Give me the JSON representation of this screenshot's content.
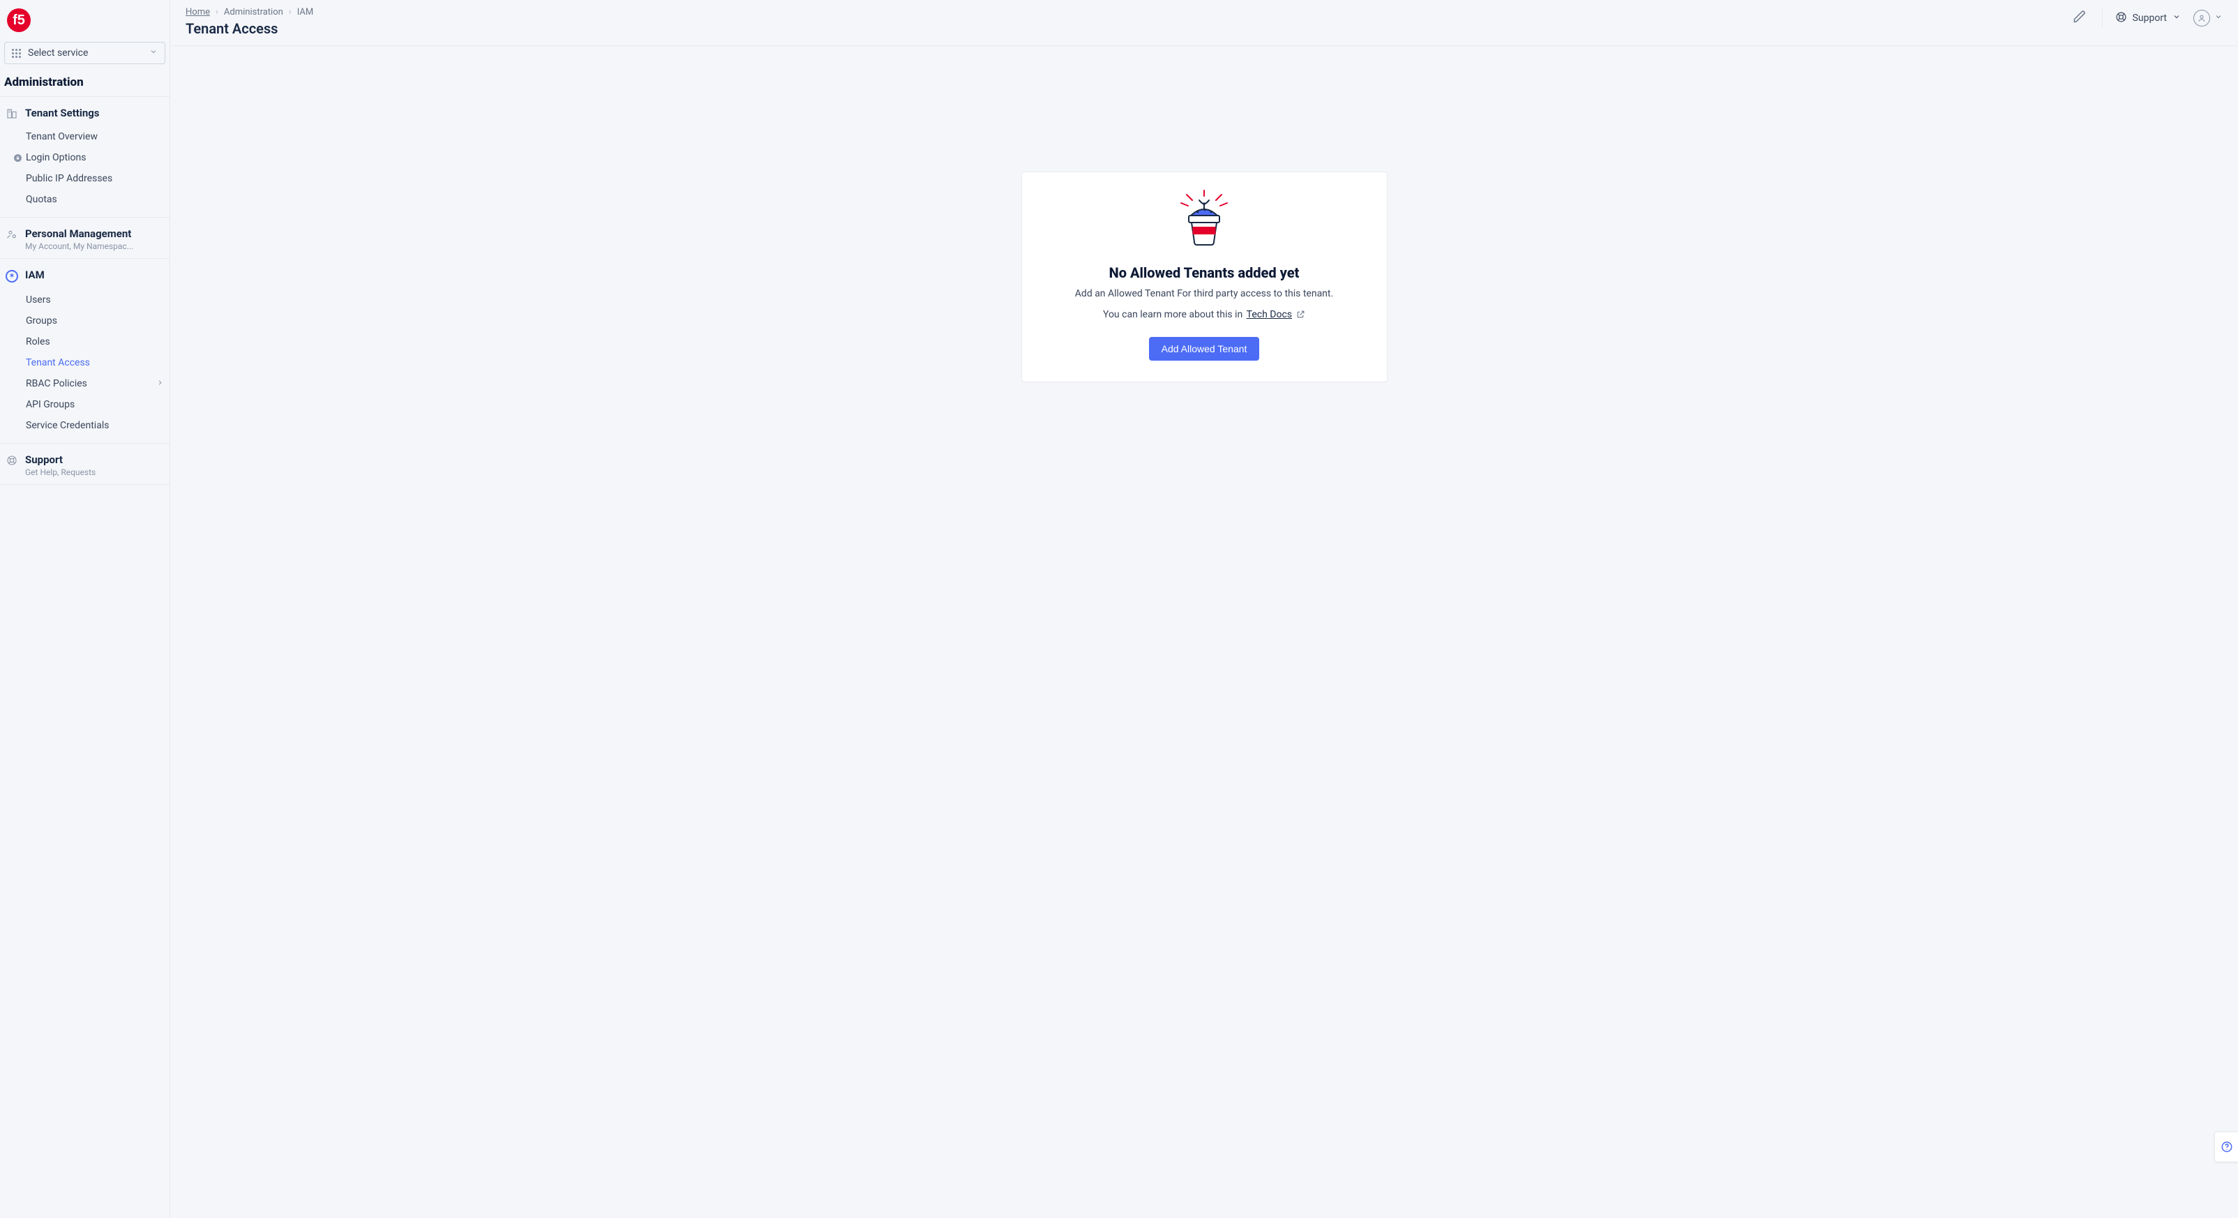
{
  "brand": "f5",
  "service_selector": {
    "label": "Select service"
  },
  "sidebar": {
    "title": "Administration",
    "groups": {
      "tenant_settings": {
        "title": "Tenant Settings",
        "items": [
          {
            "label": "Tenant Overview"
          },
          {
            "label": "Login Options"
          },
          {
            "label": "Public IP Addresses"
          },
          {
            "label": "Quotas"
          }
        ]
      },
      "personal": {
        "title": "Personal Management",
        "subtitle": "My Account, My Namespac..."
      },
      "iam": {
        "title": "IAM",
        "items": [
          {
            "label": "Users"
          },
          {
            "label": "Groups"
          },
          {
            "label": "Roles"
          },
          {
            "label": "Tenant Access"
          },
          {
            "label": "RBAC Policies"
          },
          {
            "label": "API Groups"
          },
          {
            "label": "Service Credentials"
          }
        ]
      },
      "support": {
        "title": "Support",
        "subtitle": "Get Help, Requests"
      }
    }
  },
  "breadcrumb": {
    "home": "Home",
    "admin": "Administration",
    "iam": "IAM"
  },
  "page_title": "Tenant Access",
  "top_support": "Support",
  "empty": {
    "title": "No Allowed Tenants added yet",
    "subtitle": "Add an Allowed Tenant For third party access to this tenant.",
    "learn_prefix": "You can learn more about this in ",
    "learn_link": "Tech Docs",
    "button": "Add Allowed Tenant"
  }
}
